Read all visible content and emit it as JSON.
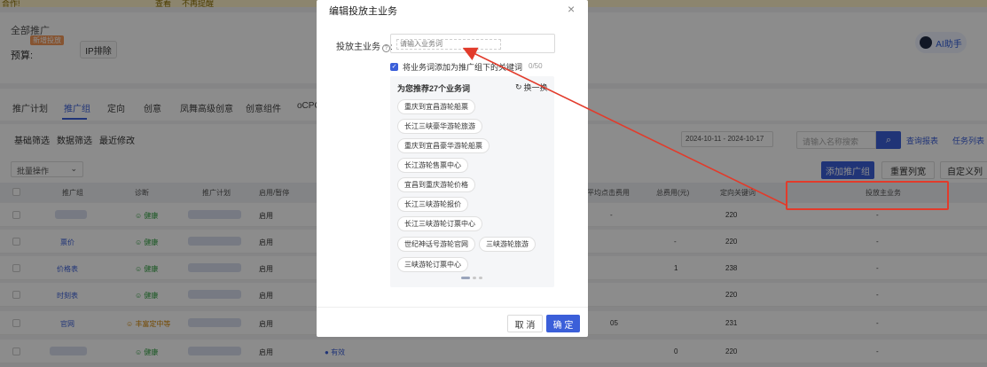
{
  "top_notice": {
    "left": "合作!",
    "middle": "查看",
    "right": "不再提醒"
  },
  "header": {
    "breadcrumb": "全部推广",
    "new_tag": "新增投放",
    "budget_label": "预算:",
    "ip_button": "IP排除",
    "ai_button": "AI助手"
  },
  "tabs": [
    "推广计划",
    "推广组",
    "定向",
    "创意",
    "凤舞高级创意",
    "创意组件",
    "oCPC"
  ],
  "toolbar": {
    "filters": [
      "基础筛选",
      "数据筛选",
      "最近修改"
    ],
    "date_range": "2024-10-11 - 2024-10-17",
    "search_placeholder": "请输入名称搜索",
    "report_link": "查询报表",
    "task_link": "任务列表",
    "batch_label": "批量操作",
    "add_button": "添加推广组",
    "set_columns": "重置列宽",
    "custom_columns": "自定义列"
  },
  "table": {
    "headers": [
      "推广组",
      "诊断",
      "推广计划",
      "启用/暂停",
      "平均点击费用",
      "总费用(元)",
      "定向关键词",
      "投放主业务"
    ],
    "rows": [
      {
        "name": "",
        "diag": "健康",
        "status": "启用",
        "avg": "-",
        "cost": "",
        "kw": "220",
        "biz": "-"
      },
      {
        "name": "票价",
        "diag": "健康",
        "status": "启用",
        "avg": "",
        "cost": "-",
        "kw": "220",
        "biz": "-"
      },
      {
        "name": "价格表",
        "diag": "健康",
        "status": "启用",
        "avg": "",
        "cost": "1",
        "kw": "238",
        "biz": "-"
      },
      {
        "name": "时刻表",
        "diag": "健康",
        "status": "启用",
        "avg": "",
        "cost": "",
        "kw": "220",
        "biz": "-"
      },
      {
        "name": "官网",
        "diag": "丰富定中等",
        "status": "启用",
        "avg": "05",
        "cost": "",
        "kw": "231",
        "biz": "-"
      },
      {
        "name": "",
        "diag": "健康",
        "status": "启用",
        "extra": "有效",
        "avg": "",
        "cost": "0",
        "kw": "220",
        "biz": "-"
      }
    ]
  },
  "modal": {
    "title": "编辑投放主业务",
    "field_label": "投放主业务",
    "input_placeholder": "请输入业务词",
    "checkbox_label": "将业务词添加为推广组下的关键词",
    "counter": "0/50",
    "rec_title": "为您推荐27个业务词",
    "refresh_label": "换一换",
    "chips": [
      "重庆到宜昌游轮船票",
      "长江三峡豪华游轮旅游",
      "重庆到宜昌豪华游轮船票",
      "长江游轮售票中心",
      "宜昌到重庆游轮价格",
      "长江三峡游轮报价",
      "长江三峡游轮订票中心",
      "世纪神话号游轮官网",
      "三峡游轮旅游",
      "三峡游轮订票中心"
    ],
    "cancel": "取 消",
    "ok": "确 定"
  },
  "colors": {
    "primary": "#3b5fd9",
    "annotation": "#e23b2b",
    "healthy": "#2e9e3e"
  }
}
